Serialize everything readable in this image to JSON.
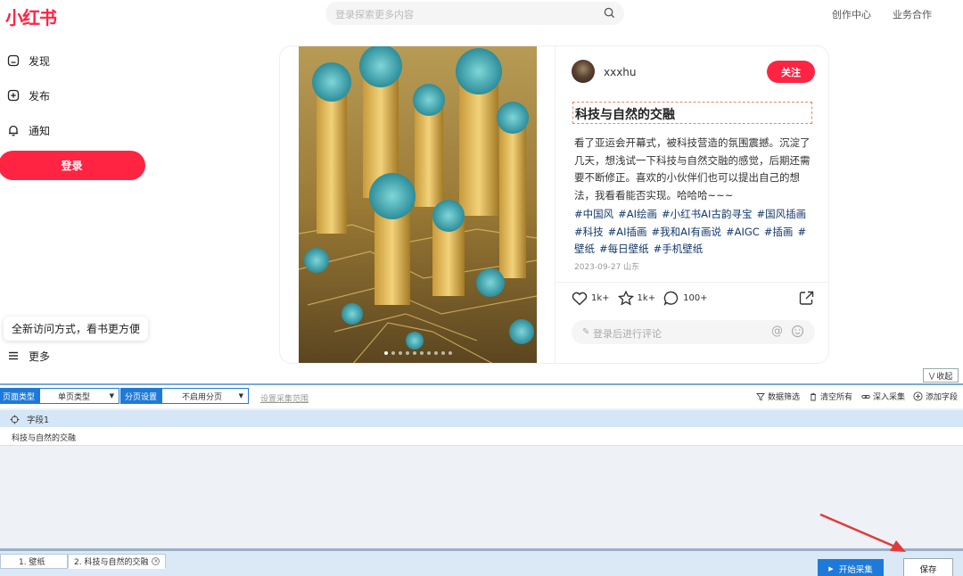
{
  "app": {
    "logo": "小红书"
  },
  "header": {
    "search_placeholder": "登录探索更多内容",
    "links": [
      "创作中心",
      "业务合作"
    ]
  },
  "sidebar": {
    "items": [
      {
        "label": "发现",
        "icon": "home-icon"
      },
      {
        "label": "发布",
        "icon": "plus-square-icon"
      },
      {
        "label": "通知",
        "icon": "bell-icon"
      }
    ],
    "login_label": "登录",
    "tip": "全新访问方式，看书更方便",
    "more_label": "更多"
  },
  "note": {
    "author": "xxxhu",
    "follow_label": "关注",
    "title": "科技与自然的交融",
    "description": "看了亚运会开幕式，被科技营造的氛围震撼。沉淀了几天，想浅试一下科技与自然交融的感觉，后期还需要不断修正。喜欢的小伙伴们也可以提出自己的想法，我看看能否实现。哈哈哈~~~",
    "tags": [
      "#中国风",
      "#AI绘画",
      "#小红书AI古韵寻宝",
      "#国风插画",
      "#科技",
      "#AI插画",
      "#我和AI有画说",
      "#AIGC",
      "#插画",
      "#壁纸",
      "#每日壁纸",
      "#手机壁纸"
    ],
    "date": "2023-09-27 山东",
    "likes": "1k+",
    "collects": "1k+",
    "comments": "100+",
    "comment_placeholder": "登录后进行评论",
    "image_count": 10,
    "image_index": 1
  },
  "collector": {
    "collapse_label": "收起",
    "page_type_label": "页面类型",
    "page_type_value": "单页类型",
    "paging_label": "分页设置",
    "paging_value": "不启用分页",
    "range_label": "设置采集范围",
    "tools": [
      "数据筛选",
      "清空所有",
      "深入采集",
      "添加字段"
    ],
    "field_name": "字段1",
    "rows": [
      "科技与自然的交融"
    ],
    "tabs": [
      "1. 壁纸",
      "2. 科技与自然的交融"
    ],
    "start_label": "开始采集",
    "save_label": "保存"
  },
  "colors": {
    "brand": "#ff2442",
    "tool_accent": "#1e7ad9",
    "annotation": "#e03a3a"
  }
}
